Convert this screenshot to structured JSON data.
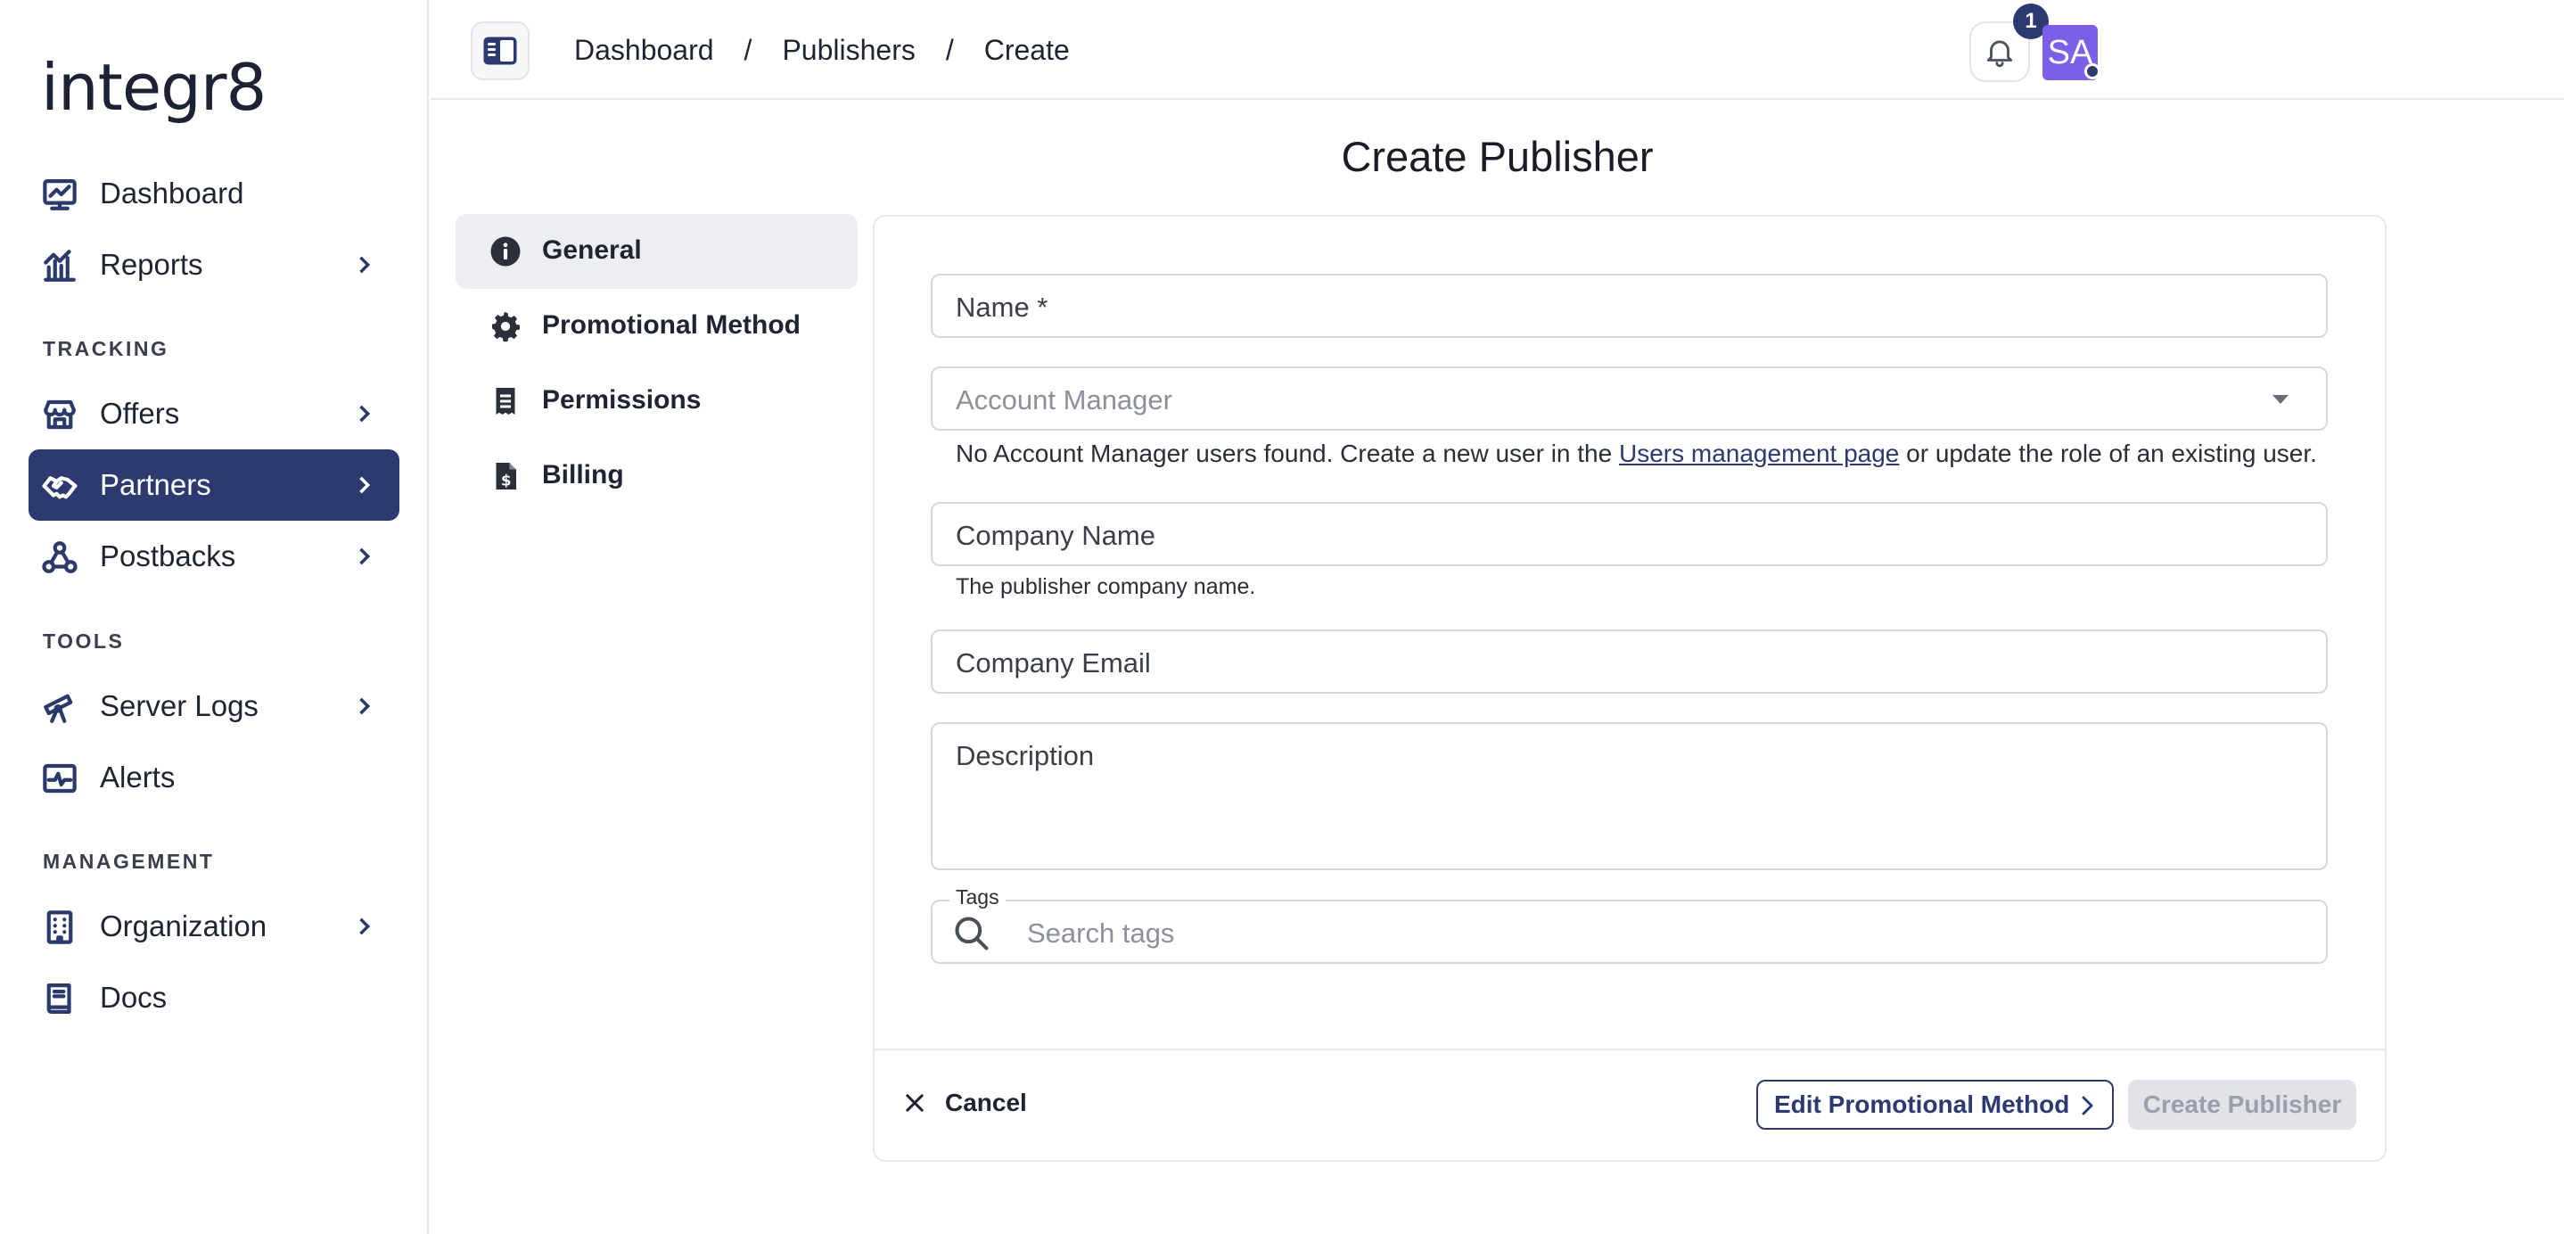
{
  "brand": {
    "logo_text": "integr8"
  },
  "sidebar": {
    "items": [
      {
        "label": "Dashboard",
        "icon": "chart-monitor-icon"
      },
      {
        "label": "Reports",
        "icon": "bar-chart-icon"
      },
      {
        "label": "Offers",
        "icon": "storefront-icon"
      },
      {
        "label": "Partners",
        "icon": "handshake-icon"
      },
      {
        "label": "Postbacks",
        "icon": "webhook-icon"
      },
      {
        "label": "Server Logs",
        "icon": "telescope-icon"
      },
      {
        "label": "Alerts",
        "icon": "pulse-monitor-icon"
      },
      {
        "label": "Organization",
        "icon": "building-icon"
      },
      {
        "label": "Docs",
        "icon": "book-icon"
      }
    ],
    "sections": {
      "tracking": "TRACKING",
      "tools": "TOOLS",
      "management": "MANAGEMENT"
    },
    "active_item": "Partners"
  },
  "header": {
    "breadcrumbs": [
      "Dashboard",
      "Publishers",
      "Create"
    ],
    "separator": "/",
    "notification_count": "1",
    "avatar_initials": "SA"
  },
  "main": {
    "title": "Create Publisher",
    "tabs": [
      {
        "label": "General",
        "icon": "info-icon"
      },
      {
        "label": "Promotional Method",
        "icon": "gear-icon"
      },
      {
        "label": "Permissions",
        "icon": "receipt-icon"
      },
      {
        "label": "Billing",
        "icon": "invoice-dollar-icon"
      }
    ],
    "active_tab": "General",
    "form": {
      "name_label": "Name *",
      "account_manager_placeholder": "Account Manager",
      "account_manager_help_prefix": "No Account Manager users found. Create a new user in the ",
      "account_manager_help_link": "Users management page",
      "account_manager_help_suffix": " or update the role of an existing user.",
      "company_name_label": "Company Name",
      "company_name_help": "The publisher company name.",
      "company_email_label": "Company Email",
      "description_label": "Description",
      "tags_legend": "Tags",
      "tags_placeholder": "Search tags"
    },
    "actions": {
      "cancel_label": "Cancel",
      "edit_promotional_label": "Edit Promotional Method",
      "create_label": "Create Publisher"
    }
  },
  "colors": {
    "accent": "#2c3a6f",
    "avatar": "#7b5fe6",
    "border": "#d5d8df"
  }
}
